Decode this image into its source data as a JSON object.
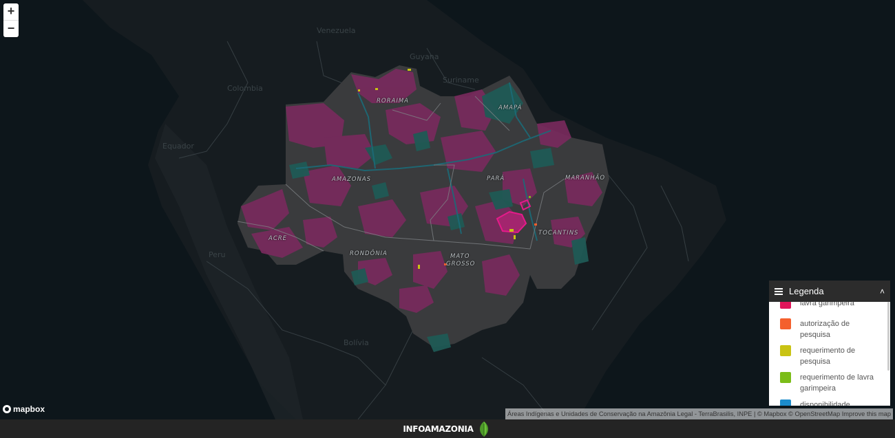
{
  "map": {
    "countries": [
      "Venezuela",
      "Guyana",
      "Suriname",
      "Colombia",
      "Equador",
      "Peru",
      "Bolívia"
    ],
    "states": [
      "RORAIMA",
      "AMAPÁ",
      "AMAZONAS",
      "PARÁ",
      "MARANHÃO",
      "ACRE",
      "RONDÔNIA",
      "MATO",
      "GROSSO",
      "TOCANTINS"
    ]
  },
  "controls": {
    "zoom_in": "+",
    "zoom_out": "−"
  },
  "legend": {
    "title": "Legenda",
    "items": [
      {
        "label": "lavra garimpeira",
        "color": "#e0155a"
      },
      {
        "label": "autorização de pesquisa",
        "color": "#f4602d"
      },
      {
        "label": "requerimento de pesquisa",
        "color": "#c9c313"
      },
      {
        "label": "requerimento de lavra garimpeira",
        "color": "#7bbd18"
      },
      {
        "label": "disponibilidade",
        "color": "#1c8ccc"
      }
    ]
  },
  "attribution": "Áreas Indígenas e Unidades de Conservação na Amazônia Legal - TerraBrasilis, INPE | © Mapbox © OpenStreetMap Improve this map",
  "logo": "mapbox",
  "footer": {
    "brand": "INFOAMAZONIA"
  }
}
